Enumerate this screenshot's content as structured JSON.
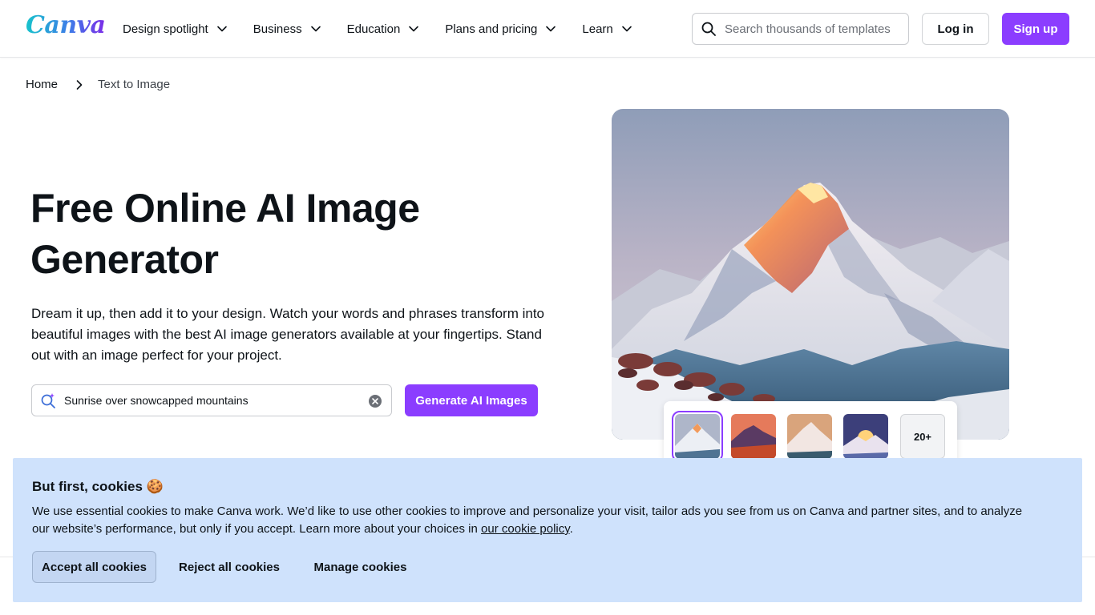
{
  "header": {
    "logo": "Canva",
    "nav": [
      {
        "label": "Design spotlight"
      },
      {
        "label": "Business"
      },
      {
        "label": "Education"
      },
      {
        "label": "Plans and pricing"
      },
      {
        "label": "Learn"
      }
    ],
    "search_placeholder": "Search thousands of templates",
    "login_label": "Log in",
    "signup_label": "Sign up"
  },
  "breadcrumb": {
    "home": "Home",
    "current": "Text to Image"
  },
  "hero": {
    "title": "Free Online AI Image Generator",
    "description": "Dream it up, then add it to your design. Watch your words and phrases transform into beautiful images with the best AI image generators available at your fingertips. Stand out with an image perfect for your project.",
    "prompt_value": "Sunrise over snowcapped mountains",
    "generate_label": "Generate AI Images",
    "more_count": "20+"
  },
  "cookie": {
    "title": "But first, cookies 🍪",
    "text_before_link": "We use essential cookies to make Canva work. We’d like to use other cookies to improve and personalize your visit, tailor ads you see from us on Canva and partner sites, and to analyze our website’s performance, but only if you accept. Learn more about your choices in ",
    "link_text": "our cookie policy",
    "text_after_link": ".",
    "accept_label": "Accept all cookies",
    "reject_label": "Reject all cookies",
    "manage_label": "Manage cookies"
  },
  "colors": {
    "brand_purple": "#8b3dff",
    "cookie_bg": "#cfe2fc"
  },
  "icons": [
    "search-icon",
    "chevron-down-icon",
    "chevron-right-icon",
    "magic-search-icon",
    "clear-icon"
  ]
}
